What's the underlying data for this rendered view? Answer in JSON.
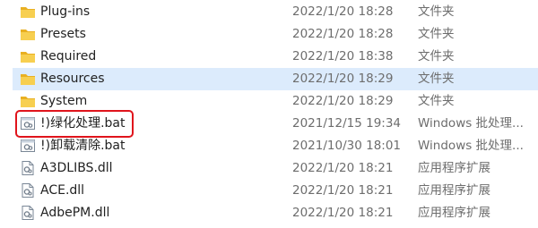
{
  "files": [
    {
      "name": "Plug-ins",
      "date": "2022/1/20 18:28",
      "type": "文件夹",
      "icon": "folder-icon",
      "selected": false
    },
    {
      "name": "Presets",
      "date": "2022/1/20 18:28",
      "type": "文件夹",
      "icon": "folder-icon",
      "selected": false
    },
    {
      "name": "Required",
      "date": "2022/1/20 18:38",
      "type": "文件夹",
      "icon": "folder-icon",
      "selected": false
    },
    {
      "name": "Resources",
      "date": "2022/1/20 18:29",
      "type": "文件夹",
      "icon": "folder-icon",
      "selected": true
    },
    {
      "name": "System",
      "date": "2022/1/20 18:29",
      "type": "文件夹",
      "icon": "folder-icon",
      "selected": false
    },
    {
      "name": "!)绿化处理.bat",
      "date": "2021/12/15 19:34",
      "type": "Windows 批处理...",
      "icon": "batch-file-icon",
      "selected": false
    },
    {
      "name": "!)卸载清除.bat",
      "date": "2021/10/30 18:01",
      "type": "Windows 批处理...",
      "icon": "batch-file-icon",
      "selected": false
    },
    {
      "name": "A3DLIBS.dll",
      "date": "2022/1/20 18:21",
      "type": "应用程序扩展",
      "icon": "dll-file-icon",
      "selected": false
    },
    {
      "name": "ACE.dll",
      "date": "2022/1/20 18:21",
      "type": "应用程序扩展",
      "icon": "dll-file-icon",
      "selected": false
    },
    {
      "name": "AdbePM.dll",
      "date": "2022/1/20 18:21",
      "type": "应用程序扩展",
      "icon": "dll-file-icon",
      "selected": false
    }
  ],
  "colors": {
    "folder": "#f4c542",
    "selection": "#dcebfc",
    "highlight": "#e0141c"
  }
}
